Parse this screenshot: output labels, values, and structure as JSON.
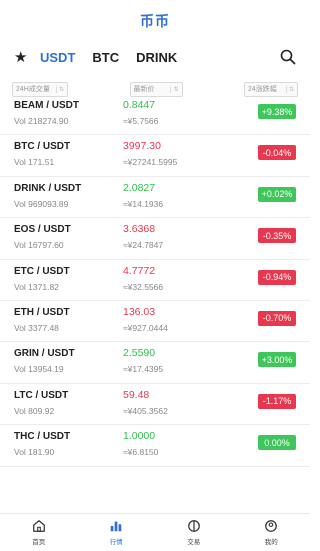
{
  "header": {
    "title": "币币"
  },
  "tabs": {
    "items": [
      "USDT",
      "BTC",
      "DRINK"
    ],
    "active": "USDT"
  },
  "sort": {
    "volume_label": "24H成交量",
    "price_label": "最新价",
    "change_label": "24涨跌幅",
    "arrow": "⇅"
  },
  "rows": [
    {
      "pair": "BEAM / USDT",
      "vol": "Vol  218274.90",
      "price": "0.8447",
      "cny": "≈¥5.7566",
      "change": "+9.38%",
      "trend": "up"
    },
    {
      "pair": "BTC / USDT",
      "vol": "Vol  171.51",
      "price": "3997.30",
      "cny": "≈¥27241.5995",
      "change": "-0.04%",
      "trend": "down"
    },
    {
      "pair": "DRINK / USDT",
      "vol": "Vol  969093.89",
      "price": "2.0827",
      "cny": "≈¥14.1936",
      "change": "+0.02%",
      "trend": "up"
    },
    {
      "pair": "EOS / USDT",
      "vol": "Vol  16797.60",
      "price": "3.6368",
      "cny": "≈¥24.7847",
      "change": "-0.35%",
      "trend": "down"
    },
    {
      "pair": "ETC / USDT",
      "vol": "Vol  1371.82",
      "price": "4.7772",
      "cny": "≈¥32.5566",
      "change": "-0.94%",
      "trend": "down"
    },
    {
      "pair": "ETH / USDT",
      "vol": "Vol  3377.48",
      "price": "136.03",
      "cny": "≈¥927.0444",
      "change": "-0.70%",
      "trend": "down"
    },
    {
      "pair": "GRIN / USDT",
      "vol": "Vol  13954.19",
      "price": "2.5590",
      "cny": "≈¥17.4395",
      "change": "+3.00%",
      "trend": "up"
    },
    {
      "pair": "LTC / USDT",
      "vol": "Vol  809.92",
      "price": "59.48",
      "cny": "≈¥405.3562",
      "change": "-1.17%",
      "trend": "down"
    },
    {
      "pair": "THC / USDT",
      "vol": "Vol  181.90",
      "price": "1.0000",
      "cny": "≈¥6.8150",
      "change": "0.00%",
      "trend": "up"
    }
  ],
  "bottom_nav": [
    {
      "label": "首页",
      "icon": "home-icon"
    },
    {
      "label": "行情",
      "icon": "chart-icon",
      "active": true
    },
    {
      "label": "交易",
      "icon": "trade-icon"
    },
    {
      "label": "我的",
      "icon": "profile-icon"
    }
  ],
  "colors": {
    "accent": "#2f6fd6",
    "up": "#3ec65a",
    "down": "#e8384f"
  }
}
